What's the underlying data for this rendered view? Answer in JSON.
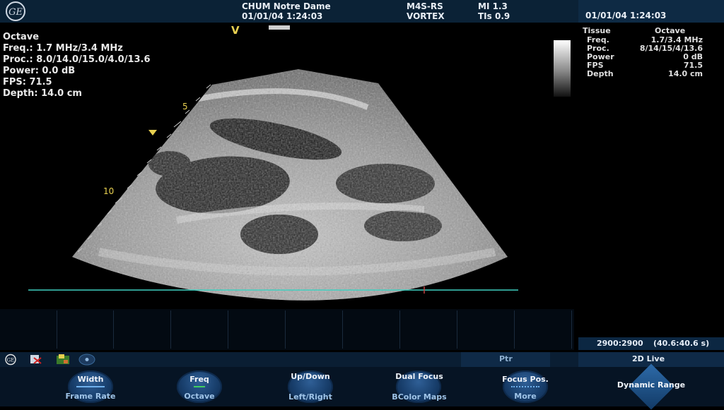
{
  "header": {
    "brand": "GE",
    "site": "CHUM Notre Dame",
    "datetime": "01/01/04 1:24:03",
    "probe": "M4S-RS",
    "preset": "VORTEX",
    "mi": "MI 1.3",
    "tis": "TIs 0.9",
    "datetime_right": "01/01/04 1:24:03"
  },
  "left_info": {
    "mode": "Octave",
    "freq": "Freq.: 1.7 MHz/3.4 MHz",
    "proc": "Proc.: 8.0/14.0/15.0/4.0/13.6",
    "power": "Power: 0.0 dB",
    "fps": "FPS: 71.5",
    "depth": "Depth: 14.0 cm"
  },
  "right_table": {
    "col1_header": "Tissue",
    "col2_header": "Octave",
    "rows": [
      {
        "label": "Freq.",
        "value": "1.7/3.4  MHz"
      },
      {
        "label": "Proc.",
        "value": "8/14/15/4/13.6"
      },
      {
        "label": "Power",
        "value": "0  dB"
      },
      {
        "label": "FPS",
        "value": "71.5"
      },
      {
        "label": "Depth",
        "value": "14.0  cm"
      }
    ]
  },
  "image": {
    "top_marker": "V",
    "depth_mark_5": "5",
    "depth_mark_10": "10"
  },
  "readouts": {
    "ratio": "2900:2900",
    "range": "(40.6:40.6 s)"
  },
  "status": {
    "ptr": "Ptr",
    "mode": "2D Live",
    "icons": [
      "ge-logo-icon",
      "export-icon",
      "image-icon",
      "record-icon"
    ]
  },
  "controls": {
    "width_label": "Width",
    "frame_rate_label": "Frame Rate",
    "freq_label": "Freq",
    "octave_label": "Octave",
    "up_down_label": "Up/Down",
    "left_right_label": "Left/Right",
    "dual_focus_label": "Dual Focus",
    "bcolor_maps_label": "BColor Maps",
    "focus_pos_label": "Focus Pos.",
    "more_label": "More",
    "dynamic_range_label": "Dynamic Range"
  },
  "colors": {
    "header_bg": "#0b2236",
    "accent": "#6fb0ec",
    "baseline": "#3fd0c0"
  }
}
